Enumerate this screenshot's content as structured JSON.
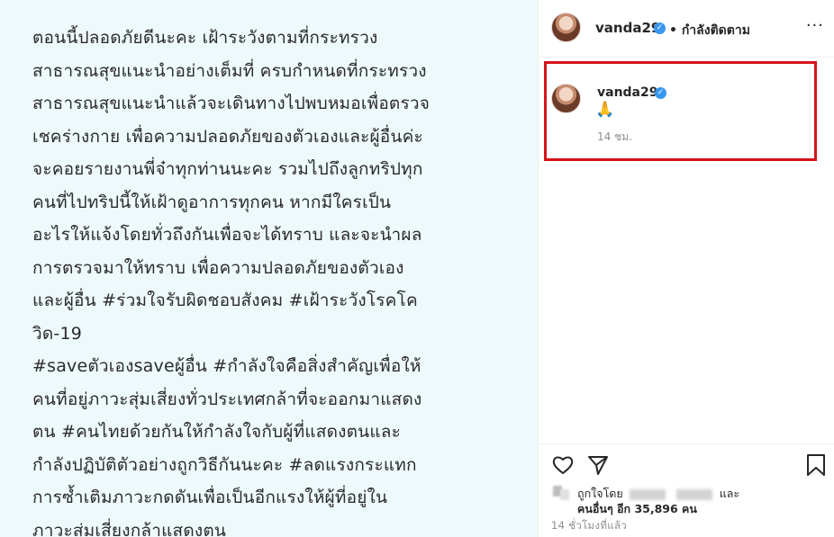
{
  "caption": {
    "lines": [
      "ตอนนี้ปลอดภัยดีนะคะ เฝ้าระวังตามที่กระทรวง",
      "สาธารณสุขแนะนำอย่างเต็มที่ ครบกำหนดที่กระทรวง",
      "สาธารณสุขแนะนำแล้วจะเดินทางไปพบหมอเพื่อตรวจ",
      "เชคร่างกาย เพื่อความปลอดภัยของตัวเองและผู้อื่นค่ะ",
      "จะคอยรายงานพี่จ๋าทุกท่านนะคะ รวมไปถึงลูกทริปทุก",
      "คนที่ไปทริปนี้ให้เฝ้าดูอาการทุกคน หากมีใครเป็น",
      "อะไรให้แจ้งโดยทั่วถึงกันเพื่อจะได้ทราบ และจะนำผล",
      "การตรวจมาให้ทราบ เพื่อความปลอดภัยของตัวเอง",
      "และผู้อื่น #ร่วมใจรับผิดชอบสังคม #เฝ้าระวังโรคโค",
      "วิด-19",
      "#saveตัวเองsaveผู้อื่น #กำลังใจคือสิ่งสำคัญเพื่อให้",
      "คนที่อยู่ภาวะสุ่มเสี่ยงทั่วประเทศกล้าที่จะออกมาแสดง",
      "ตน #คนไทยด้วยกันให้กำลังใจกับผู้ที่แสดงตนและ",
      "กำลังปฏิบัติตัวอย่างถูกวิธีกันนะคะ #ลดแรงกระแทก",
      "การซ้ำเติมภาวะกดดันเพื่อเป็นอีกแรงให้ผู้ที่อยู่ใน",
      "ภาวะสุ่มเสี่ยงกล้าแสดงตน"
    ]
  },
  "header": {
    "username": "vanda29",
    "verified_mark": "✓",
    "follow_status": "• กำลังติดตาม",
    "more_icon": "more-dots-icon",
    "more_glyph": "···"
  },
  "comment": {
    "username": "vanda29",
    "verified_mark": "✓",
    "emoji": "🙏",
    "time": "14 ชม."
  },
  "actions": {
    "icons": [
      "heart-icon",
      "send-icon",
      "bookmark-icon"
    ],
    "liked_by_prefix": "ถูกใจโดย",
    "liked_by_and": "และ",
    "others": "คนอื่นๆ อีก 35,896 คน",
    "time_ago": "14 ชั่วโมงที่แล้ว"
  },
  "colors": {
    "highlight_border": "#d4141b",
    "verified": "#3897f0",
    "caption_bg": "#eef9fb"
  }
}
